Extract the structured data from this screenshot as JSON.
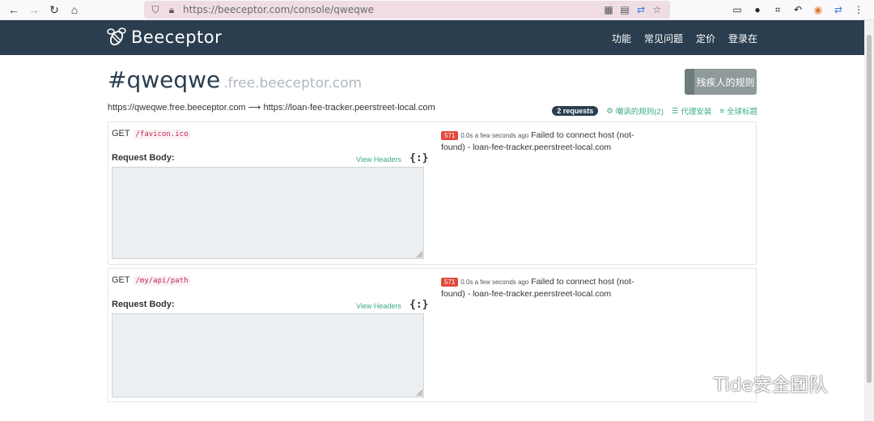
{
  "browser": {
    "url": "https://beeceptor.com/console/qweqwe"
  },
  "navbar": {
    "brand": "Beeceptor",
    "links": [
      "功能",
      "常见问题",
      "定价",
      "登录在"
    ]
  },
  "header": {
    "endpoint": "#qweqwe",
    "domain": ".free.beeceptor.com",
    "rules_button": "残疾人的规则",
    "proxy_source": "https://qweqwe.free.beeceptor.com",
    "proxy_target": "https://loan-fee-tracker.peerstreet-local.com"
  },
  "toolbar": {
    "requests_badge": "2 requests",
    "mock_rules": "嘲讽的规则(2)",
    "proxy_setup": "代理安装",
    "global_headers": "全球标题"
  },
  "requests": [
    {
      "method": "GET",
      "path": "/favicon.ico",
      "body_label": "Request Body:",
      "view_headers": "View Headers",
      "status_code": "571",
      "timing": "0.0s a few seconds ago",
      "message": "Failed to connect host (not-found) - loan-fee-tracker.peerstreet-local.com"
    },
    {
      "method": "GET",
      "path": "/my/api/path",
      "body_label": "Request Body:",
      "view_headers": "View Headers",
      "status_code": "571",
      "timing": "0.0s a few seconds ago",
      "message": "Failed to connect host (not-found) - loan-fee-tracker.peerstreet-local.com"
    }
  ],
  "watermark": "Tide安全团队",
  "icons": {
    "back": "arrow-left-icon",
    "forward": "arrow-right-icon",
    "reload": "reload-icon",
    "home": "home-icon",
    "shield": "shield-icon",
    "lock": "lock-icon",
    "qr": "qr-code-icon",
    "reader": "reader-icon",
    "translate": "translate-icon",
    "star": "star-icon",
    "json": "json-braces-icon"
  },
  "colors": {
    "navbar": "#2b3e4f",
    "accent": "#3aa98c",
    "error": "#e3493b",
    "url_bar": "#f0dde4"
  }
}
